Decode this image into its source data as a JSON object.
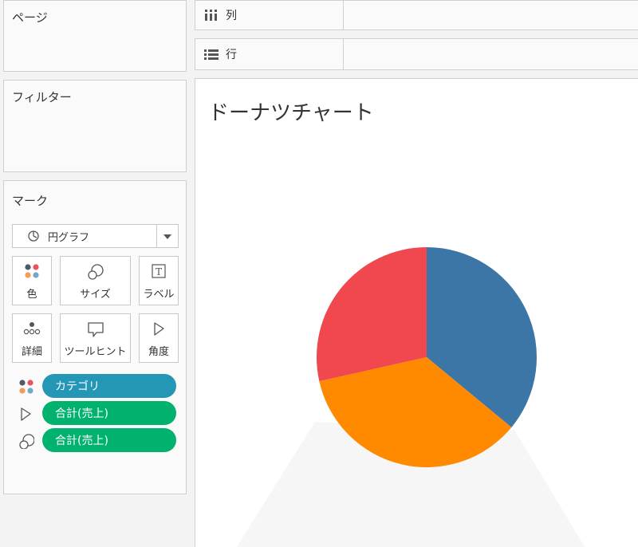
{
  "panels": {
    "pages": "ページ",
    "filters": "フィルター",
    "marks": "マーク"
  },
  "shelves": {
    "columns": "列",
    "rows": "行"
  },
  "marks_card": {
    "mark_type": "円グラフ",
    "buttons": {
      "color": "色",
      "size": "サイズ",
      "label": "ラベル",
      "detail": "詳細",
      "tooltip": "ツールヒント",
      "angle": "角度"
    },
    "pills": [
      {
        "label": "カテゴリ",
        "color": "#2496b6",
        "icon": "color-dots-icon"
      },
      {
        "label": "合計(売上)",
        "color": "#00b26d",
        "icon": "angle-icon"
      },
      {
        "label": "合計(売上)",
        "color": "#00b26d",
        "icon": "size-icon"
      }
    ]
  },
  "view": {
    "title": "ドーナツチャート"
  },
  "chart_data": {
    "type": "pie",
    "slices": [
      {
        "value": 36.0,
        "color": "#3b76a7"
      },
      {
        "value": 35.5,
        "color": "#ff8a00"
      },
      {
        "value": 28.5,
        "color": "#f0484e"
      }
    ],
    "start_angle_deg": 0,
    "direction": "clockwise",
    "background_shape_color": "#f6f6f6"
  }
}
